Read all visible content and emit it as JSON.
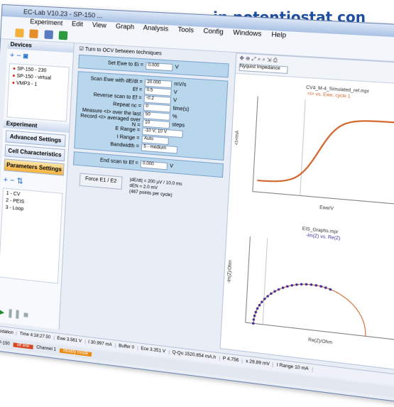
{
  "headline": "in potentiostat con",
  "window": {
    "title": "EC-Lab V10.23 - SP-150 ..."
  },
  "menu": [
    "Experiment",
    "Edit",
    "View",
    "Graph",
    "Analysis",
    "Tools",
    "Config",
    "Windows",
    "Help"
  ],
  "devices": {
    "title": "Devices",
    "items": [
      "SP-150 - 230",
      "SP-150 - virtual",
      "VMP3 - 1"
    ]
  },
  "experiment": {
    "title": "Experiment",
    "buttons": [
      "Advanced Settings",
      "Cell Characteristics",
      "Parameters Settings"
    ],
    "techniques": [
      "1 - CV",
      "2 - PEIS",
      "3 - Loop"
    ]
  },
  "params": {
    "ocv_checkbox": "Turn to OCV between techniques",
    "set_label": "Set Ewe to Ei =",
    "set_value": "0.000",
    "scan_label": "Scan Ewe with dE/dt =",
    "scan_value": "20.000",
    "scan_unit": "mV/s",
    "potential_label": "Ef =",
    "potential_value": "0.5",
    "reverse_label": "Reverse scan to Ef =",
    "reverse_value": "-0.2",
    "repeat_label": "Repeat nc =",
    "repeat_value": "0",
    "measure_label": "Measure <I> over the last",
    "measure_value": "50",
    "record_label": "Record <I> averaged over N =",
    "record_value": "10",
    "erange_label": "E Range =",
    "erange_value": "-10 V; 10 V",
    "irange_label": "I Range =",
    "irange_value": "Auto",
    "bandwidth_label": "Bandwidth =",
    "bandwidth_value": "5 - medium",
    "end_label": "End scan to Ef =",
    "end_value": "0.000",
    "force_button": "Force E1 / E2",
    "info": [
      "|dE/dt| = 200 µV / 10.0 ms",
      "dEN = 2.0 mV",
      "(467 points per cycle)"
    ]
  },
  "graph": {
    "toolbar_select": "Nyquist Impedance",
    "chart1_title": "CV4_M-4_Simulated_ref.mpr",
    "chart1_legend": "<I> vs. Ewe, cycle 1",
    "chart1_xlabel": "Ewe/V",
    "chart1_ylabel": "<I>/mA",
    "chart2_title": "EIS_Graphs.mpr",
    "chart2_legend": "-Im(Z) vs. Re(Z)",
    "chart2_xlabel": "Re(Z)/Ohm",
    "chart2_ylabel": "-Im(Z)/Ohm"
  },
  "status": {
    "status": "Oxidation",
    "time": "Time  4:18:27.50",
    "ewe": "Ewe  3.561 V",
    "i": "I  30.997 mA",
    "buffer": "Buffer  0",
    "ece": "Ece  3.351 V",
    "qqo": "Q-Qo  1520.854 mA.h",
    "p": "P  4.756",
    "x": "x  29.89 mV",
    "iRange": "I Range  10 mA"
  },
  "bottom": {
    "device": "SP-150",
    "state": "off line",
    "channel": "Channel 1",
    "modify": "Modify mode"
  },
  "colors": {
    "accent": "#1e4fa0",
    "curve": "#d0642a",
    "nyquist": "#3a2f9c",
    "panel": "#b8d6ec"
  }
}
